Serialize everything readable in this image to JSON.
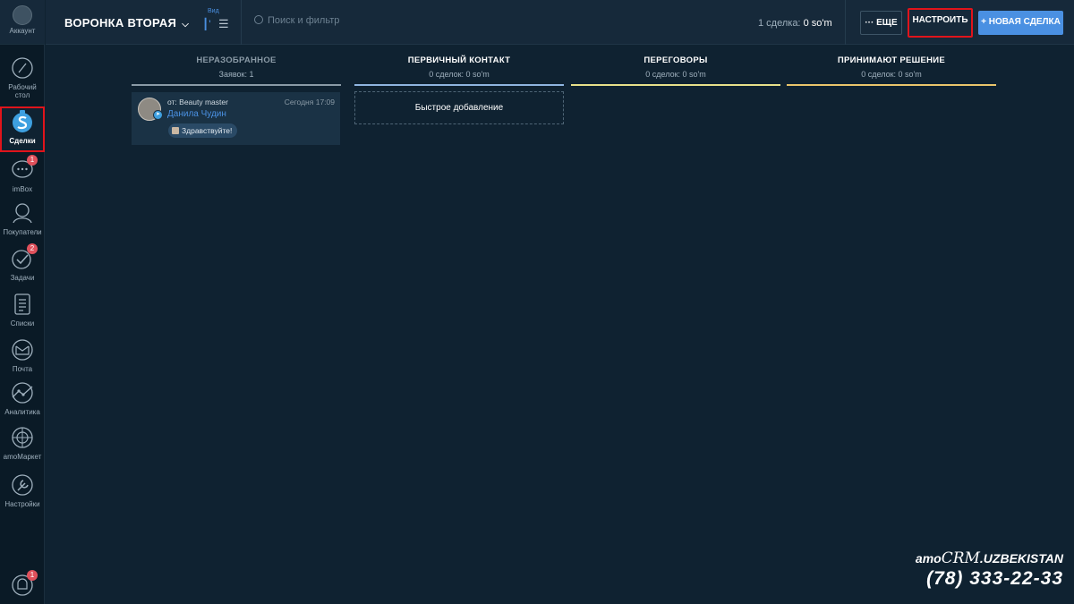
{
  "sidebar": {
    "account": "Аккаунт",
    "items": [
      {
        "label": "Рабочий стол",
        "icon": "dashboard-icon"
      },
      {
        "label": "Сделки",
        "icon": "deals-icon"
      },
      {
        "label": "imBox",
        "icon": "imbox-icon",
        "badge": "1"
      },
      {
        "label": "Покупатели",
        "icon": "customers-icon"
      },
      {
        "label": "Задачи",
        "icon": "tasks-icon",
        "badge": "2"
      },
      {
        "label": "Списки",
        "icon": "lists-icon"
      },
      {
        "label": "Почта",
        "icon": "mail-icon"
      },
      {
        "label": "Аналитика",
        "icon": "analytics-icon"
      },
      {
        "label": "amoМаркет",
        "icon": "market-icon"
      },
      {
        "label": "Настройки",
        "icon": "settings-icon"
      }
    ],
    "notifications_badge": "1"
  },
  "topbar": {
    "pipeline": "ВОРОНКА ВТОРАЯ",
    "view_label": "Вид",
    "search_placeholder": "Поиск и фильтр",
    "summary_prefix": "1 сделка:",
    "summary_value": "0 so'm",
    "more_label": "··· ЕЩЕ",
    "configure_label": "НАСТРОИТЬ",
    "new_deal_label": "+ НОВАЯ СДЕЛКА"
  },
  "columns": [
    {
      "name": "НЕРАЗОБРАННОЕ",
      "sub": "Заявок: 1",
      "color": "#8a9aa6"
    },
    {
      "name": "ПЕРВИЧНЫЙ КОНТАКТ",
      "sub": "0 сделок: 0 so'm",
      "color": "#8fb5e0"
    },
    {
      "name": "ПЕРЕГОВОРЫ",
      "sub": "0 сделок: 0 so'm",
      "color": "#e7e08a"
    },
    {
      "name": "ПРИНИМАЮТ РЕШЕНИЕ",
      "sub": "0 сделок: 0 so'm",
      "color": "#e9c56b"
    }
  ],
  "card": {
    "from": "от: Beauty master",
    "time": "Сегодня 17:09",
    "name": "Данила Чудин",
    "message": "Здравствуйте!"
  },
  "quick_add": "Быстрое добавление",
  "brand": {
    "prefix": "amo",
    "crm": "CRM",
    "suffix": ".UZBEKISTAN",
    "phone": "(78) 333-22-33"
  }
}
